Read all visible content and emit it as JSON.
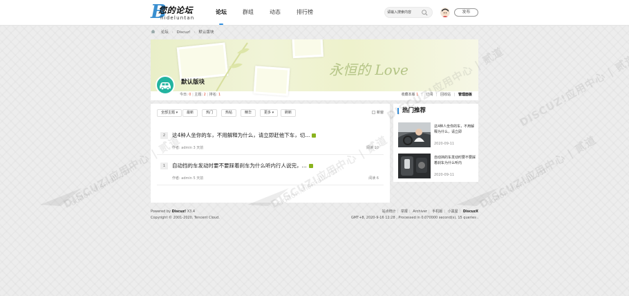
{
  "header": {
    "logo_cn": "您的论坛",
    "logo_en": "nideluntan",
    "nav": [
      "论坛",
      "群组",
      "动态",
      "排行榜"
    ],
    "search_placeholder": "请输入搜索内容",
    "post_label": "发布"
  },
  "breadcrumb": [
    "论坛",
    "Discuz!",
    "默认版块"
  ],
  "forum": {
    "name": "默认版块",
    "stats_today_label": "今日:",
    "stats_today": "0",
    "stats_topics_label": "主题:",
    "stats_topics": "2",
    "stats_rank_label": "排名:",
    "stats_rank": "1",
    "favorites_label": "收藏本版",
    "favorites_count": "1",
    "subscribe": "订阅",
    "recycle": "回收站",
    "manage": "管理面板",
    "banner_text": "永恒的 Love"
  },
  "filters": [
    "全部主题",
    "最新",
    "热门",
    "热帖",
    "精华",
    "更多",
    "刷新"
  ],
  "new_label": "新窗",
  "threads": [
    {
      "num": "2",
      "title": "这4种人坐你的车，不用解释为什么，请立即赶他下车，切...",
      "meta": "作者: admin    3 天前",
      "views": "阅读 10"
    },
    {
      "num": "1",
      "title": "自动挡的车发动时要不要踩着刹车为什么听内行人说完，...",
      "meta": "作者: admin    5 天前",
      "views": "阅读 6"
    }
  ],
  "sidebar": {
    "title": "热门推荐",
    "items": [
      {
        "text": "这4种人坐你的车，不用解释为什么，请立即",
        "date": "2020-09-11"
      },
      {
        "text": "自动挡的车发动时要不要踩着刹车为什么听内",
        "date": "2020-09-11"
      }
    ]
  },
  "footer": {
    "powered_prefix": "Powered by ",
    "powered_brand": "Discuz!",
    "powered_version": " X3.4",
    "copyright": "Copyright © 2001-2020, Tencent Cloud.",
    "links": [
      "站点统计",
      "举报",
      "Archiver",
      "手机版",
      "小黑屋"
    ],
    "brand": "DiscuzX",
    "runtime": "GMT+8, 2020-9-16 12:28 , Processed in 0.070000 second(s), 15 queries ."
  },
  "watermark": {
    "text": "DISCUZ!应用中心 | 贰道",
    "sub": "addon.dismall.com"
  },
  "colors": {
    "accent": "#2f8fe0",
    "count_red": "#e34a2c",
    "forum_icon": "#22b4a0"
  }
}
